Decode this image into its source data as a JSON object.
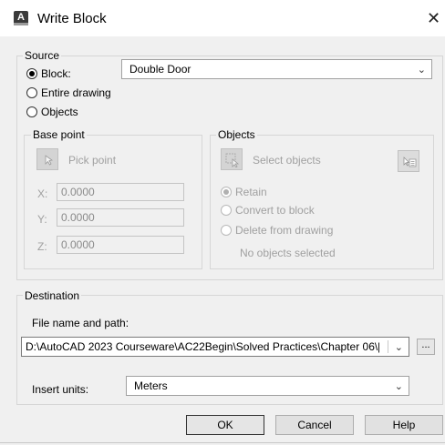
{
  "window": {
    "title": "Write Block",
    "close_label": "✕",
    "app_icon_letter": "A"
  },
  "source": {
    "label": "Source",
    "options": [
      {
        "label": "Block:",
        "selected": true
      },
      {
        "label": "Entire drawing",
        "selected": false
      },
      {
        "label": "Objects",
        "selected": false
      }
    ],
    "block_select": {
      "value": "Double Door"
    }
  },
  "base_point": {
    "label": "Base point",
    "pick_label": "Pick point",
    "x_label": "X:",
    "x_value": "0.0000",
    "y_label": "Y:",
    "y_value": "0.0000",
    "z_label": "Z:",
    "z_value": "0.0000"
  },
  "objects": {
    "label": "Objects",
    "select_label": "Select objects",
    "options": [
      {
        "label": "Retain",
        "selected": true
      },
      {
        "label": "Convert to block",
        "selected": false
      },
      {
        "label": "Delete from drawing",
        "selected": false
      }
    ],
    "status": "No objects selected"
  },
  "destination": {
    "label": "Destination",
    "file_label": "File name and path:",
    "file_path": "D:\\AutoCAD 2023 Courseware\\AC22Begin\\Solved Practices\\Chapter 06\\[",
    "browse_label": "...",
    "units_label": "Insert units:",
    "units_value": "Meters"
  },
  "buttons": {
    "ok": "OK",
    "cancel": "Cancel",
    "help": "Help"
  }
}
